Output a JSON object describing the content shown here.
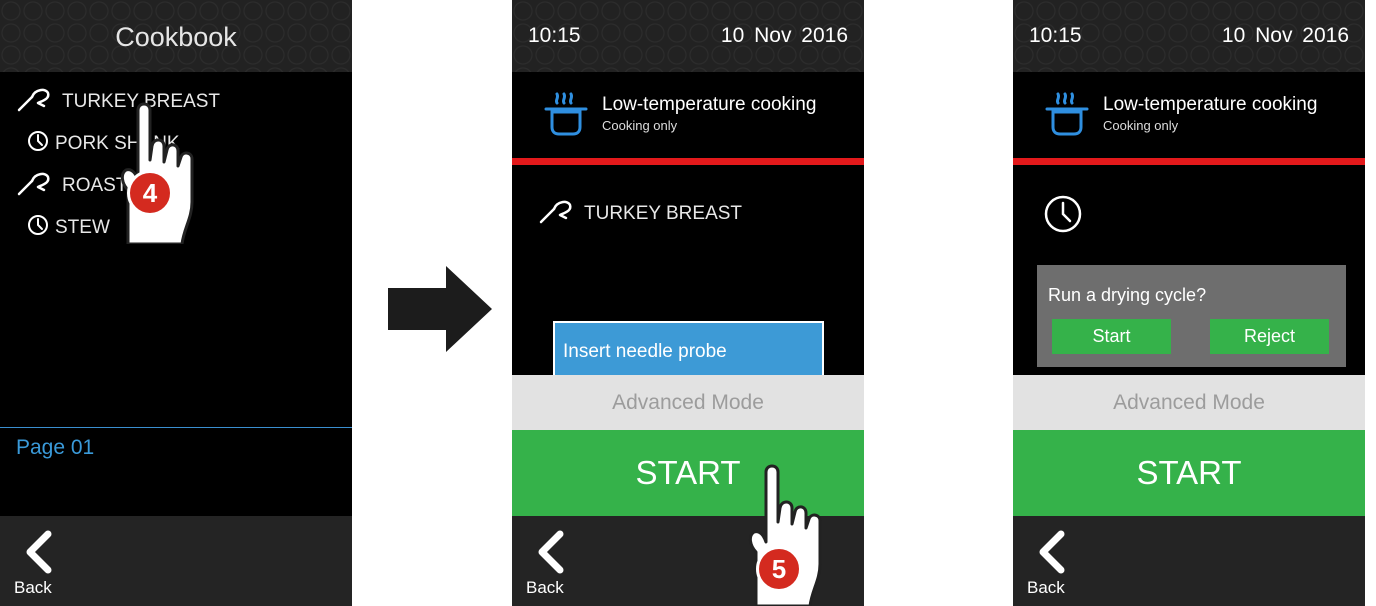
{
  "screen1": {
    "title": "Cookbook",
    "recipes": [
      {
        "label": "TURKEY BREAST",
        "icon": "probe-icon"
      },
      {
        "label": "PORK SHANK",
        "icon": "clock-icon"
      },
      {
        "label": "ROAST",
        "icon": "probe-icon"
      },
      {
        "label": "STEW",
        "icon": "clock-icon"
      }
    ],
    "page_label": "Page 01",
    "back_label": "Back",
    "step_badge": "4"
  },
  "screen2": {
    "time": "10:15",
    "date": "10 Nov 2016",
    "mode_title": "Low-temperature cooking",
    "mode_subtitle": "Cooking only",
    "recipe": "TURKEY BREAST",
    "probe_message": "Insert needle probe",
    "advanced_mode": "Advanced Mode",
    "start": "START",
    "back_label": "Back",
    "step_badge": "5"
  },
  "screen3": {
    "time": "10:15",
    "date": "10 Nov 2016",
    "mode_title": "Low-temperature cooking",
    "mode_subtitle": "Cooking only",
    "dialog_question": "Run a drying cycle?",
    "dialog_start": "Start",
    "dialog_reject": "Reject",
    "advanced_mode": "Advanced Mode",
    "start": "START",
    "back_label": "Back"
  },
  "colors": {
    "accent_blue": "#3a9ad9",
    "start_green": "#35b24a",
    "separator_red": "#e3191b",
    "badge_red": "#d42a1f"
  }
}
